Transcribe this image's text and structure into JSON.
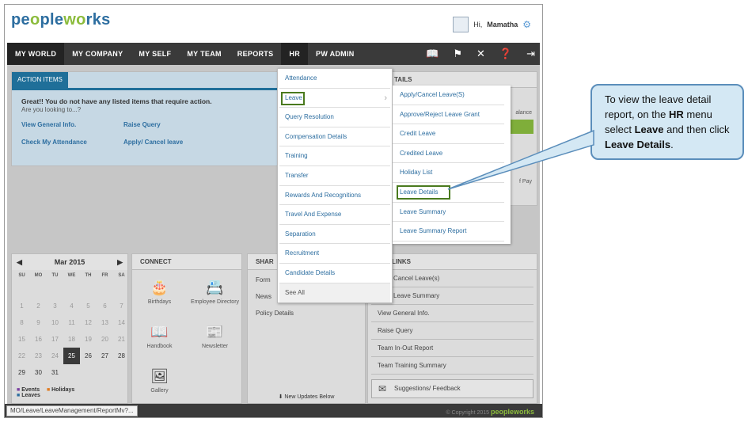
{
  "header": {
    "logo_a": "pe",
    "logo_b": "o",
    "logo_c": "ple",
    "logo_d": "w",
    "logo_e": "o",
    "logo_f": "rks",
    "greeting": "Hi,",
    "user_name": "Mamatha"
  },
  "nav": {
    "items": [
      "MY WORLD",
      "MY COMPANY",
      "MY SELF",
      "MY TEAM",
      "REPORTS",
      "HR",
      "PW ADMIN"
    ],
    "active": "HR"
  },
  "actions": {
    "tab": "ACTION ITEMS",
    "message": "Great!! You do not have any listed items that require action.",
    "prompt": "Are you looking to...?",
    "links": [
      "View General Info.",
      "Raise Query",
      "Check My Attendance",
      "Apply/ Cancel leave"
    ]
  },
  "details": {
    "head": "TAILS",
    "balance_text": "alance",
    "pay_text": "f Pay"
  },
  "calendar": {
    "month": "Mar 2015",
    "prev": "◀",
    "next": "▶",
    "daynames": [
      "SU",
      "MO",
      "TU",
      "WE",
      "TH",
      "FR",
      "SA"
    ],
    "days": [
      [
        "",
        "",
        "",
        "",
        "",
        "",
        ""
      ],
      [
        "1",
        "2",
        "3",
        "4",
        "5",
        "6",
        "7"
      ],
      [
        "8",
        "9",
        "10",
        "11",
        "12",
        "13",
        "14"
      ],
      [
        "15",
        "16",
        "17",
        "18",
        "19",
        "20",
        "21"
      ],
      [
        "22",
        "23",
        "24",
        "25",
        "26",
        "27",
        "28"
      ],
      [
        "29",
        "30",
        "31",
        "",
        "",
        "",
        ""
      ]
    ],
    "today": "25",
    "legend_events": "Events",
    "legend_leaves": "Leaves",
    "legend_holidays": "Holidays"
  },
  "connect": {
    "title": "CONNECT",
    "tiles": [
      "Birthdays",
      "Employee Directory",
      "Handbook",
      "Newsletter",
      "Gallery"
    ]
  },
  "share": {
    "title": "SHAR",
    "rows": [
      "Form",
      "News",
      "Policy Details"
    ],
    "footer": "New Updates Below"
  },
  "quick": {
    "title": "K LINKS",
    "rows": [
      "Cancel Leave(s)",
      "Leave Summary",
      "View General Info.",
      "Raise Query",
      "Team In-Out Report",
      "Team Training Summary"
    ],
    "feedback": "Suggestions/ Feedback"
  },
  "hr_menu": {
    "items": [
      "Attendance",
      "Leave",
      "Query Resolution",
      "Compensation Details",
      "Training",
      "Transfer",
      "Rewards And Recognitions",
      "Travel And Expense",
      "Separation",
      "Recruitment",
      "Candidate Details",
      "See All"
    ],
    "selected": "Leave"
  },
  "leave_submenu": {
    "items": [
      "Apply/Cancel Leave(S)",
      "Approve/Reject Leave Grant",
      "Credit Leave",
      "Credited Leave",
      "Holiday List",
      "Leave Details",
      "Leave Summary",
      "Leave Summary Report"
    ],
    "selected": "Leave Details"
  },
  "status": {
    "url": "MO/Leave/LeaveManagement/ReportMv?...",
    "copyright": "© Copyright 2015",
    "brand": "peopleworks"
  },
  "callout": {
    "t1": "To view the leave detail report, on the ",
    "t2": "HR",
    "t3": " menu select ",
    "t4": "Leave",
    "t5": " and then click ",
    "t6": "Leave Details",
    "t7": "."
  },
  "colors": {
    "accent": "#2d6ea0",
    "brand_green": "#8cbc3c",
    "highlight": "#4a7a1e",
    "nav": "#3a3a3a"
  }
}
